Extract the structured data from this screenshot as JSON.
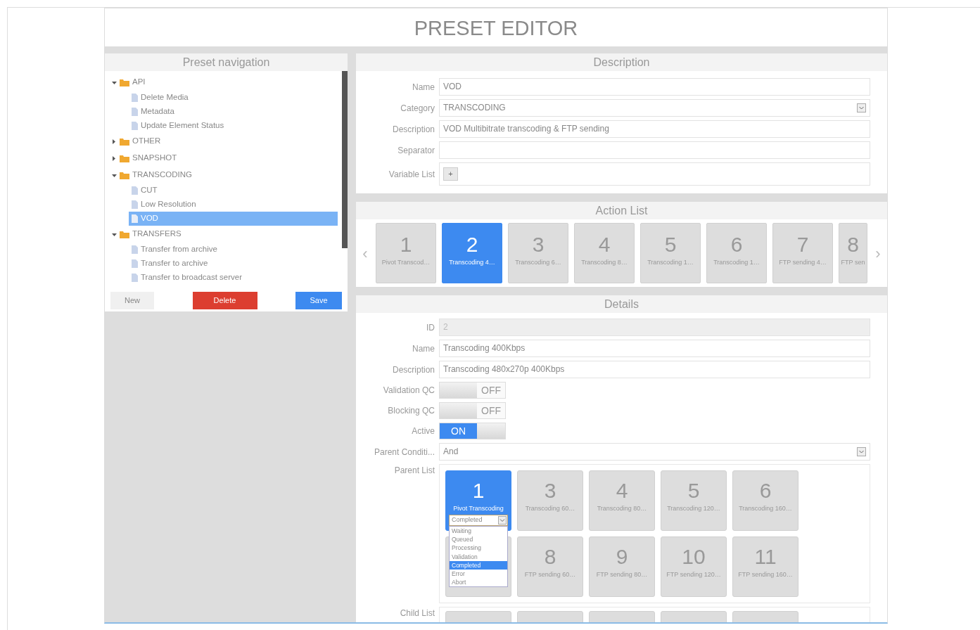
{
  "title": "PRESET EDITOR",
  "navigation": {
    "title": "Preset navigation",
    "tree": [
      {
        "label": "API",
        "expanded": true,
        "children": [
          {
            "label": "Delete Media",
            "selected": false
          },
          {
            "label": "Metadata",
            "selected": false
          },
          {
            "label": "Update Element Status",
            "selected": false
          }
        ]
      },
      {
        "label": "OTHER",
        "expanded": false
      },
      {
        "label": "SNAPSHOT",
        "expanded": false
      },
      {
        "label": "TRANSCODING",
        "expanded": true,
        "children": [
          {
            "label": "CUT",
            "selected": false
          },
          {
            "label": "Low Resolution",
            "selected": false
          },
          {
            "label": "VOD",
            "selected": true
          }
        ]
      },
      {
        "label": "TRANSFERS",
        "expanded": true,
        "children": [
          {
            "label": "Transfer from archive",
            "selected": false
          },
          {
            "label": "Transfer to archive",
            "selected": false
          },
          {
            "label": "Transfer to broadcast server",
            "selected": false
          }
        ]
      }
    ],
    "buttons": [
      {
        "label": "New",
        "kind": "default"
      },
      {
        "label": "Delete",
        "kind": "danger"
      },
      {
        "label": "Save",
        "kind": "primary"
      }
    ]
  },
  "description": {
    "title": "Description",
    "fields": [
      {
        "label": "Name",
        "kind": "text",
        "value": "VOD"
      },
      {
        "label": "Category",
        "kind": "select",
        "value": "TRANSCODING"
      },
      {
        "label": "Description",
        "kind": "text",
        "value": "VOD Multibitrate transcoding & FTP sending"
      },
      {
        "label": "Separator",
        "kind": "text"
      },
      {
        "label": "Variable List",
        "kind": "add",
        "button": "+"
      }
    ]
  },
  "action_list": {
    "title": "Action List",
    "prev": "‹",
    "next": "›",
    "items": [
      {
        "number": "1",
        "label": "Pivot Transcod…",
        "selected": false
      },
      {
        "number": "2",
        "label": "Transcoding 4…",
        "selected": true
      },
      {
        "number": "3",
        "label": "Transcoding 6…",
        "selected": false
      },
      {
        "number": "4",
        "label": "Transcoding 8…",
        "selected": false
      },
      {
        "number": "5",
        "label": "Transcoding 1…",
        "selected": false
      },
      {
        "number": "6",
        "label": "Transcoding 1…",
        "selected": false
      },
      {
        "number": "7",
        "label": "FTP sending 4…",
        "selected": false
      },
      {
        "number": "8",
        "label": "FTP sen",
        "selected": false
      }
    ]
  },
  "details": {
    "title": "Details",
    "fields": [
      {
        "label": "ID",
        "kind": "text",
        "value": "2",
        "disabled": true
      },
      {
        "label": "Name",
        "kind": "text",
        "value": "Transcoding 400Kbps",
        "disabled": false
      },
      {
        "label": "Description",
        "kind": "text",
        "value": "Transcoding 480x270p 400Kbps",
        "disabled": false
      },
      {
        "label": "Validation QC",
        "kind": "toggle",
        "on": false,
        "text": "OFF"
      },
      {
        "label": "Blocking QC",
        "kind": "toggle",
        "on": false,
        "text": "OFF"
      },
      {
        "label": "Active",
        "kind": "toggle",
        "on": true,
        "text": "ON"
      },
      {
        "label": "Parent Conditi...",
        "kind": "select",
        "value": "And"
      }
    ],
    "parent_list": {
      "label": "Parent List",
      "tiles": [
        {
          "kind": "tile",
          "number": "1",
          "label": "Pivot Transcoding",
          "selected": true,
          "status": {
            "value": "Completed",
            "options": [
              {
                "label": "Waiting",
                "selected": false
              },
              {
                "label": "Queued",
                "selected": false
              },
              {
                "label": "Processing",
                "selected": false
              },
              {
                "label": "Validation",
                "selected": false
              },
              {
                "label": "Completed",
                "selected": true
              },
              {
                "label": "Error",
                "selected": false
              },
              {
                "label": "Abort",
                "selected": false
              }
            ]
          }
        },
        {
          "kind": "tile",
          "number": "3",
          "label": "Transcoding 60…",
          "selected": false
        },
        {
          "kind": "tile",
          "number": "4",
          "label": "Transcoding 80…",
          "selected": false
        },
        {
          "kind": "tile",
          "number": "5",
          "label": "Transcoding 120…",
          "selected": false
        },
        {
          "kind": "tile",
          "number": "6",
          "label": "Transcoding 160…",
          "selected": false
        },
        {
          "kind": "covered"
        },
        {
          "kind": "tile",
          "number": "8",
          "label": "FTP sending 60…",
          "selected": false
        },
        {
          "kind": "tile",
          "number": "9",
          "label": "FTP sending 80…",
          "selected": false
        },
        {
          "kind": "tile",
          "number": "10",
          "label": "FTP sending 120…",
          "selected": false
        },
        {
          "kind": "tile",
          "number": "11",
          "label": "FTP sending 160…",
          "selected": false
        }
      ]
    },
    "child_list": {
      "label": "Child List"
    }
  }
}
